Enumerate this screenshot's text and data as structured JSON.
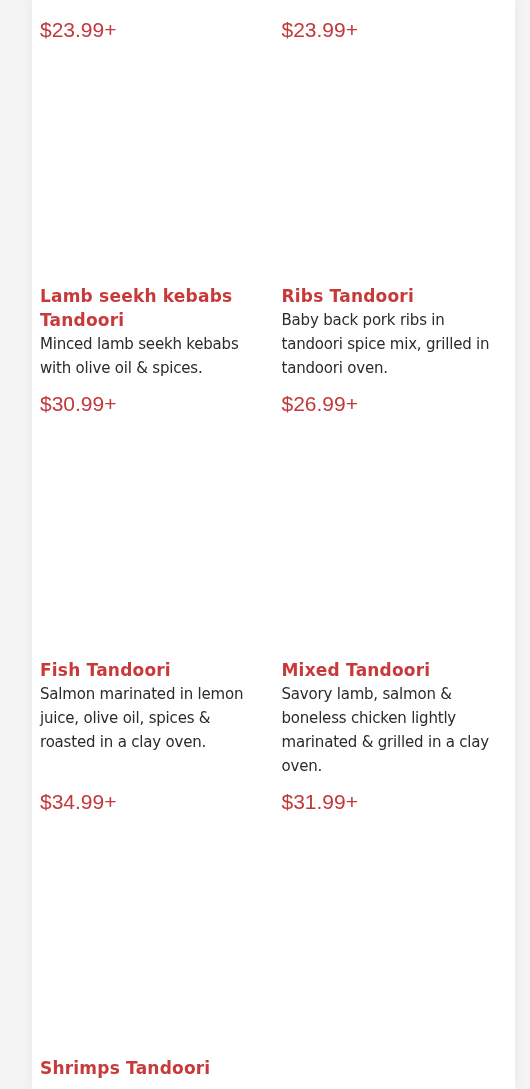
{
  "menu_items": [
    {
      "price": "$23.99+"
    },
    {
      "price": "$23.99+"
    },
    {
      "title": "Lamb seekh kebabs Tandoori",
      "description": "Minced lamb seekh kebabs with olive oil & spices.",
      "price": "$30.99+"
    },
    {
      "title": "Ribs Tandoori",
      "description": "Baby back pork ribs in tandoori spice mix, grilled in tandoori oven.",
      "price": "$26.99+"
    },
    {
      "title": "Fish Tandoori",
      "description": "Salmon marinated in lemon juice, olive oil, spices & roasted in a clay oven.",
      "price": "$34.99+"
    },
    {
      "title": "Mixed Tandoori",
      "description": "Savory lamb, salmon & boneless chicken lightly marinated & grilled in a clay oven.",
      "price": "$31.99+"
    },
    {
      "title": "Shrimps Tandoori"
    }
  ]
}
